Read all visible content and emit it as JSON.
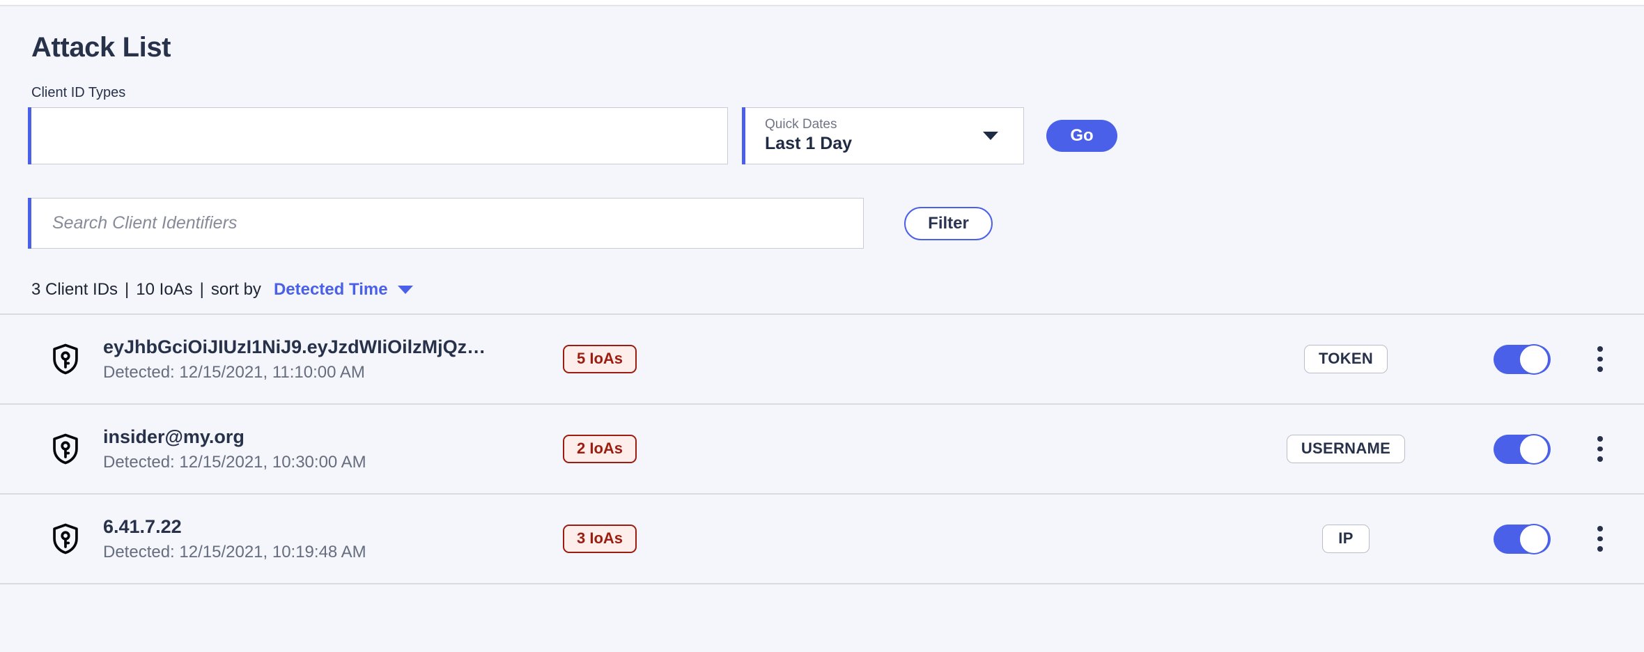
{
  "page": {
    "title": "Attack List",
    "accent_color": "#4a60e8",
    "background_color": "#f5f6fb",
    "text_color": "#27314a"
  },
  "filters": {
    "client_id_types": {
      "label": "Client ID Types",
      "value": "",
      "placeholder": ""
    },
    "quick_dates": {
      "caption": "Quick Dates",
      "value": "Last 1 Day",
      "options": [
        "Last 1 Day"
      ],
      "arrow_icon": "chevron-down-icon"
    },
    "go_label": "Go"
  },
  "search": {
    "placeholder": "Search Client Identifiers",
    "value": "",
    "filter_label": "Filter"
  },
  "summary": {
    "client_ids": "3 Client IDs",
    "separator_1": "|",
    "ioas": "10 IoAs",
    "separator_2": "|",
    "sort_by_label": "sort by",
    "sort_value": "Detected Time",
    "sort_arrow_icon": "chevron-down-icon"
  },
  "list": {
    "rows": [
      {
        "icon": "shield-key-icon",
        "identifier": "eyJhbGciOiJIUzI1NiJ9.eyJzdWIiOilzMjQz…",
        "detected": "Detected: 12/15/2021, 11:10:00 AM",
        "ioa_badge": "5 IoAs",
        "type_badge": "TOKEN",
        "toggle_on": true,
        "menu_icon": "kebab-menu-icon"
      },
      {
        "icon": "shield-key-icon",
        "identifier": "insider@my.org",
        "detected": "Detected: 12/15/2021, 10:30:00 AM",
        "ioa_badge": "2 IoAs",
        "type_badge": "USERNAME",
        "toggle_on": true,
        "menu_icon": "kebab-menu-icon"
      },
      {
        "icon": "shield-key-icon",
        "identifier": "6.41.7.22",
        "detected": "Detected: 12/15/2021, 10:19:48 AM",
        "ioa_badge": "3 IoAs",
        "type_badge": "IP",
        "toggle_on": true,
        "menu_icon": "kebab-menu-icon"
      }
    ]
  }
}
